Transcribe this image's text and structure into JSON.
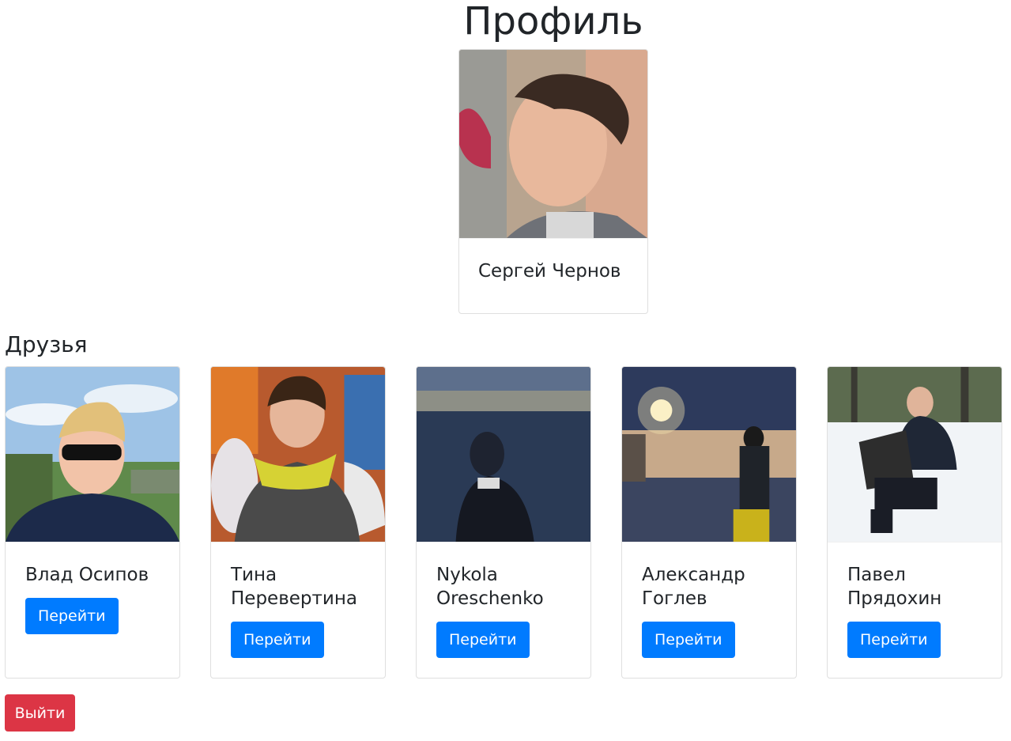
{
  "page": {
    "title": "Профиль"
  },
  "profile": {
    "name": "Сергей Чернов"
  },
  "friends": {
    "heading": "Друзья",
    "items": [
      {
        "name": "Влад Осипов",
        "button_label": "Перейти"
      },
      {
        "name": "Тина Перевертина",
        "button_label": "Перейти"
      },
      {
        "name": "Nykola Oreschenko",
        "button_label": "Перейти"
      },
      {
        "name": "Александр Гоглев",
        "button_label": "Перейти"
      },
      {
        "name": "Павел Прядохин",
        "button_label": "Перейти"
      }
    ]
  },
  "footer": {
    "logout_label": "Выйти"
  },
  "colors": {
    "primary": "#007bff",
    "danger": "#dc3545",
    "text": "#212529"
  }
}
